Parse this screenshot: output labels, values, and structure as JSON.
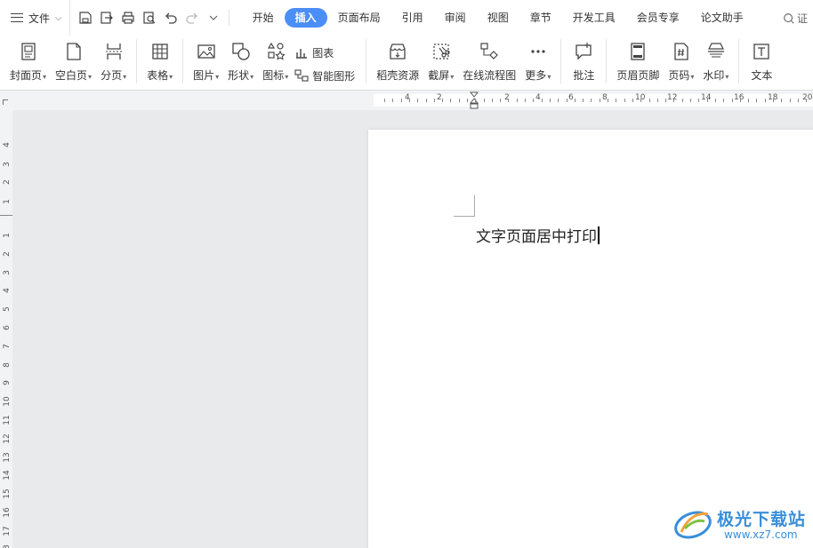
{
  "menu": {
    "file_label": "文件",
    "tabs": [
      {
        "label": "开始",
        "active": false
      },
      {
        "label": "插入",
        "active": true
      },
      {
        "label": "页面布局",
        "active": false
      },
      {
        "label": "引用",
        "active": false
      },
      {
        "label": "审阅",
        "active": false
      },
      {
        "label": "视图",
        "active": false
      },
      {
        "label": "章节",
        "active": false
      },
      {
        "label": "开发工具",
        "active": false
      },
      {
        "label": "会员专享",
        "active": false
      },
      {
        "label": "论文助手",
        "active": false
      }
    ],
    "search_partial": "证"
  },
  "ribbon": {
    "cover_page": "封面页",
    "blank_page": "空白页",
    "page_break": "分页",
    "table": "表格",
    "picture": "图片",
    "shape": "形状",
    "icon": "图标",
    "chart": "图表",
    "smart_art": "智能图形",
    "docer_resources": "稻壳资源",
    "screenshot": "截屏",
    "online_flowchart": "在线流程图",
    "more": "更多",
    "comment": "批注",
    "header_footer": "页眉页脚",
    "page_number": "页码",
    "watermark": "水印",
    "textbox_partial": "文本"
  },
  "hruler": {
    "labels": [
      "4",
      "2",
      "2",
      "4",
      "6",
      "8",
      "10",
      "12",
      "14",
      "16",
      "18",
      "20"
    ]
  },
  "vruler": {
    "labels_top": [
      "4",
      "3",
      "2",
      "1"
    ],
    "labels_main": [
      "1",
      "2",
      "3",
      "4",
      "5",
      "6",
      "7",
      "8",
      "9",
      "10",
      "11",
      "12",
      "13",
      "14",
      "15",
      "16",
      "17",
      "18"
    ]
  },
  "document": {
    "text": "文字页面居中打印"
  },
  "watermark_site": {
    "name": "极光下载站",
    "url": "www.xz7.com"
  },
  "colors": {
    "accent": "#4c8ef7",
    "watermark": "#3a8ed8"
  }
}
